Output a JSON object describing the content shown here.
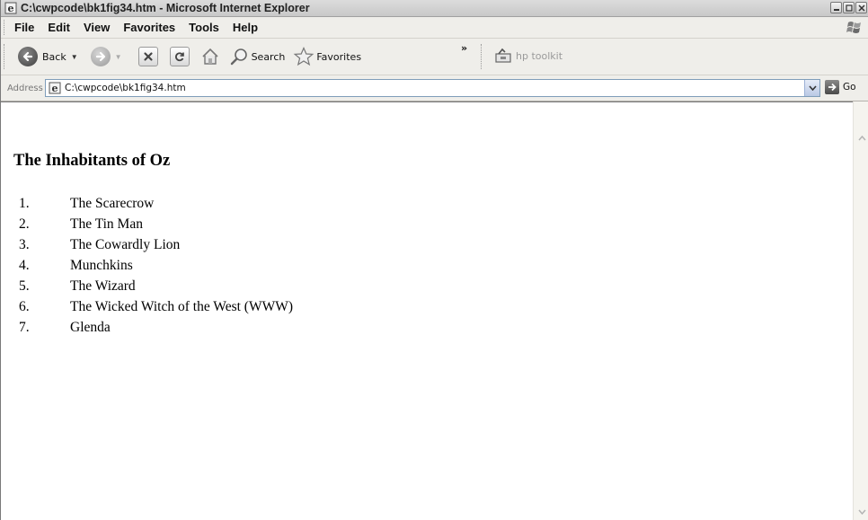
{
  "window": {
    "title": "C:\\cwpcode\\bk1fig34.htm - Microsoft Internet Explorer"
  },
  "menu": {
    "items": [
      "File",
      "Edit",
      "View",
      "Favorites",
      "Tools",
      "Help"
    ]
  },
  "toolbar": {
    "back_label": "Back",
    "search_label": "Search",
    "favorites_label": "Favorites",
    "more_label": "»",
    "hp_toolkit_label": "hp toolkit"
  },
  "address": {
    "label": "Address",
    "value": "C:\\cwpcode\\bk1fig34.htm",
    "go_label": "Go"
  },
  "page": {
    "heading": "The Inhabitants of Oz",
    "list": [
      {
        "num": "1.",
        "text": "The Scarecrow"
      },
      {
        "num": "2.",
        "text": "The Tin Man"
      },
      {
        "num": "3.",
        "text": "The Cowardly Lion"
      },
      {
        "num": "4.",
        "text": "Munchkins"
      },
      {
        "num": "5.",
        "text": "The Wizard"
      },
      {
        "num": "6.",
        "text": "The Wicked Witch of the West (WWW)"
      },
      {
        "num": "7.",
        "text": "Glenda"
      }
    ]
  },
  "icons": {
    "title_icon": "ie-page-icon",
    "back_icon": "back-arrow-icon",
    "forward_icon": "forward-arrow-icon",
    "stop_icon": "stop-icon",
    "refresh_icon": "refresh-icon",
    "home_icon": "home-icon",
    "search_icon": "magnifier-icon",
    "favorites_icon": "star-icon",
    "hp_toolkit_icon": "hp-toolkit-icon",
    "go_icon": "go-arrow-icon"
  },
  "colors": {
    "back_button": "#4d4d4d",
    "forward_button": "#9a9a9a",
    "link_field_border": "#7f9db9"
  }
}
